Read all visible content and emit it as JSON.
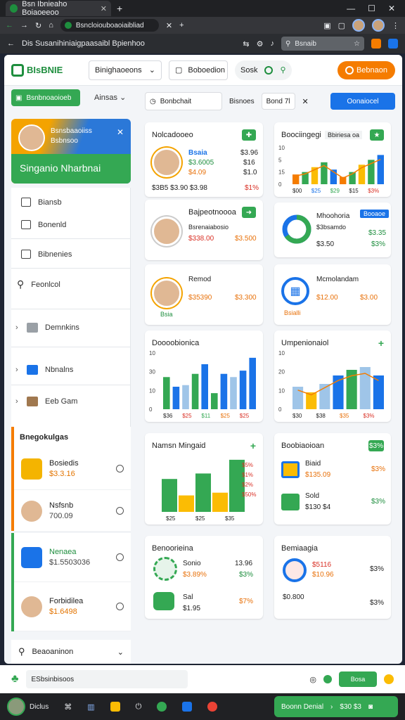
{
  "browser": {
    "tab_title": "Bsn Ibnieaho Boiaoeeoo",
    "omnibox": "Bsncloiouboaoiaibliad",
    "page_heading": "Dis Susanihiniaigpaasaibl Bpienhoo",
    "bookmark_search": "Bsnaib"
  },
  "app": {
    "logo": "BIsBNIE",
    "select1": "Binighaoeons",
    "select2": "Boboedion",
    "seg_label": "Sosk",
    "orange_button": "Bebnaon"
  },
  "sidebar": {
    "top_button": "Bsnbnoaoioeb",
    "top_dropdown": "Ainsas",
    "profile_title": "Bsnsbaaoiiss",
    "profile_sub": "Bsbnsoo",
    "profile_name": "Singanio Nharbnai",
    "menu": [
      "Biansb",
      "Bonenld",
      "Bibnenies",
      "Feonlcol",
      "Demnkins",
      "Nbnalns",
      "Eeb Gam"
    ],
    "section_title": "Bnegokulgas",
    "products": [
      {
        "name": "Bosiedis",
        "price": "$3.3.16"
      },
      {
        "name": "Nsfsnb",
        "price": "700.09"
      },
      {
        "name": "Nenaea",
        "price": "$1.5503036"
      },
      {
        "name": "Forbidilea",
        "price": "$1.6498"
      }
    ],
    "footer": "Beaoaninon"
  },
  "filters": {
    "search": "Bonbchait",
    "label": "Bisnoes",
    "date": "Bond 7l",
    "primary": "Oonaiocel"
  },
  "cards": {
    "c1": {
      "title": "Nolcadooeo",
      "name": "Bsaia",
      "v1": "$3.96",
      "v2": "$16",
      "v3": "$1.0",
      "v4": "$15",
      "a1": "$3.6005",
      "a2": "$4.09",
      "f1": "$3B5 $3.90 $3.98",
      "f2": "$1%"
    },
    "c2": {
      "title": "Boociingegi",
      "chip": "Bbiriesa oa",
      "ticks": [
        "10",
        "5",
        "15",
        "0"
      ],
      "x": [
        "$00",
        "$25",
        "$29",
        "$15",
        "$3%"
      ]
    },
    "c3": {
      "title": "Bajpeotnoooa",
      "sub": "Bsrenaiabosio",
      "v1": "$338.00",
      "v2": "$3.500"
    },
    "c4": {
      "title": "Mhoohoria",
      "chip": "Booaoe",
      "sub": "$3bsamdo",
      "v1": "$3.35",
      "v2": "$3.50",
      "v3": "$3%"
    },
    "c5": {
      "title": "Remod",
      "sub": "Bsia",
      "v1": "$35390",
      "v2": "$3.300"
    },
    "c6": {
      "title": "Mcmolandam",
      "sub": "Bsialli",
      "v1": "$12.00",
      "v2": "$3.00"
    },
    "c7": {
      "title": "Doooobionica",
      "ticks": [
        "10",
        "30",
        "10",
        "0"
      ],
      "x": [
        "$36",
        "$25",
        "$11",
        "$25",
        "$25"
      ]
    },
    "c8": {
      "title": "Umpenionaiol",
      "ticks": [
        "10",
        "20",
        "10",
        "0"
      ],
      "x": [
        "$30",
        "$38",
        "$35",
        "$3%"
      ]
    },
    "c9": {
      "title": "Namsn Mingaid",
      "vals": [
        "$5%",
        "$1%",
        "$2%",
        "$50%"
      ],
      "x": [
        "$25",
        "$25",
        "$35"
      ]
    },
    "c10": {
      "title": "Boobiaoioan",
      "chip": "$3%",
      "r1": "Biaid",
      "r1a": "$135.09",
      "r1b": "$3%",
      "r2": "Sold",
      "r2a": "$130 $4",
      "r2b": "$3%"
    },
    "c11": {
      "title": "Benoorieina",
      "r1": "Sonio",
      "r1a": "$3.89%",
      "r1b": "13.96",
      "r1c": "$3%",
      "r2": "Sal",
      "r2a": "$1.95",
      "r2b": "$7%"
    },
    "c12": {
      "title": "Bemiaagia",
      "r1": "$5116",
      "r1a": "$10.96",
      "r1b": "$3%",
      "r2": "$0.800",
      "r2a": "$3%"
    }
  },
  "chart_data": [
    {
      "type": "bar",
      "categories": [
        "$00",
        "$25",
        "$29",
        "$15",
        "$3%"
      ],
      "series": [
        {
          "values": [
            4,
            5,
            7,
            9,
            6
          ]
        },
        {
          "values": [
            3,
            5,
            8,
            10,
            12
          ]
        }
      ],
      "ylim": [
        0,
        15
      ]
    },
    {
      "type": "bar",
      "categories": [
        "$36",
        "$25",
        "$11",
        "$25",
        "$25"
      ],
      "series": [
        {
          "values": [
            20,
            14,
            15,
            22,
            28
          ]
        },
        {
          "values": [
            10,
            22,
            20,
            24,
            32
          ]
        }
      ],
      "ylim": [
        0,
        35
      ]
    },
    {
      "type": "bar",
      "categories": [
        "$30",
        "$38",
        "$35",
        "$3%"
      ],
      "series": [
        {
          "values": [
            8,
            6,
            9,
            12,
            14,
            15,
            12
          ]
        }
      ],
      "ylim": [
        0,
        20
      ]
    }
  ],
  "bottom": {
    "input": "ESbsinbisoos",
    "button": "Bosa",
    "task_button": "Boonn Denial",
    "task_value": "$30 $3"
  },
  "colors": {
    "green": "#34a853",
    "orange": "#f57c00",
    "blue": "#1a73e8"
  }
}
